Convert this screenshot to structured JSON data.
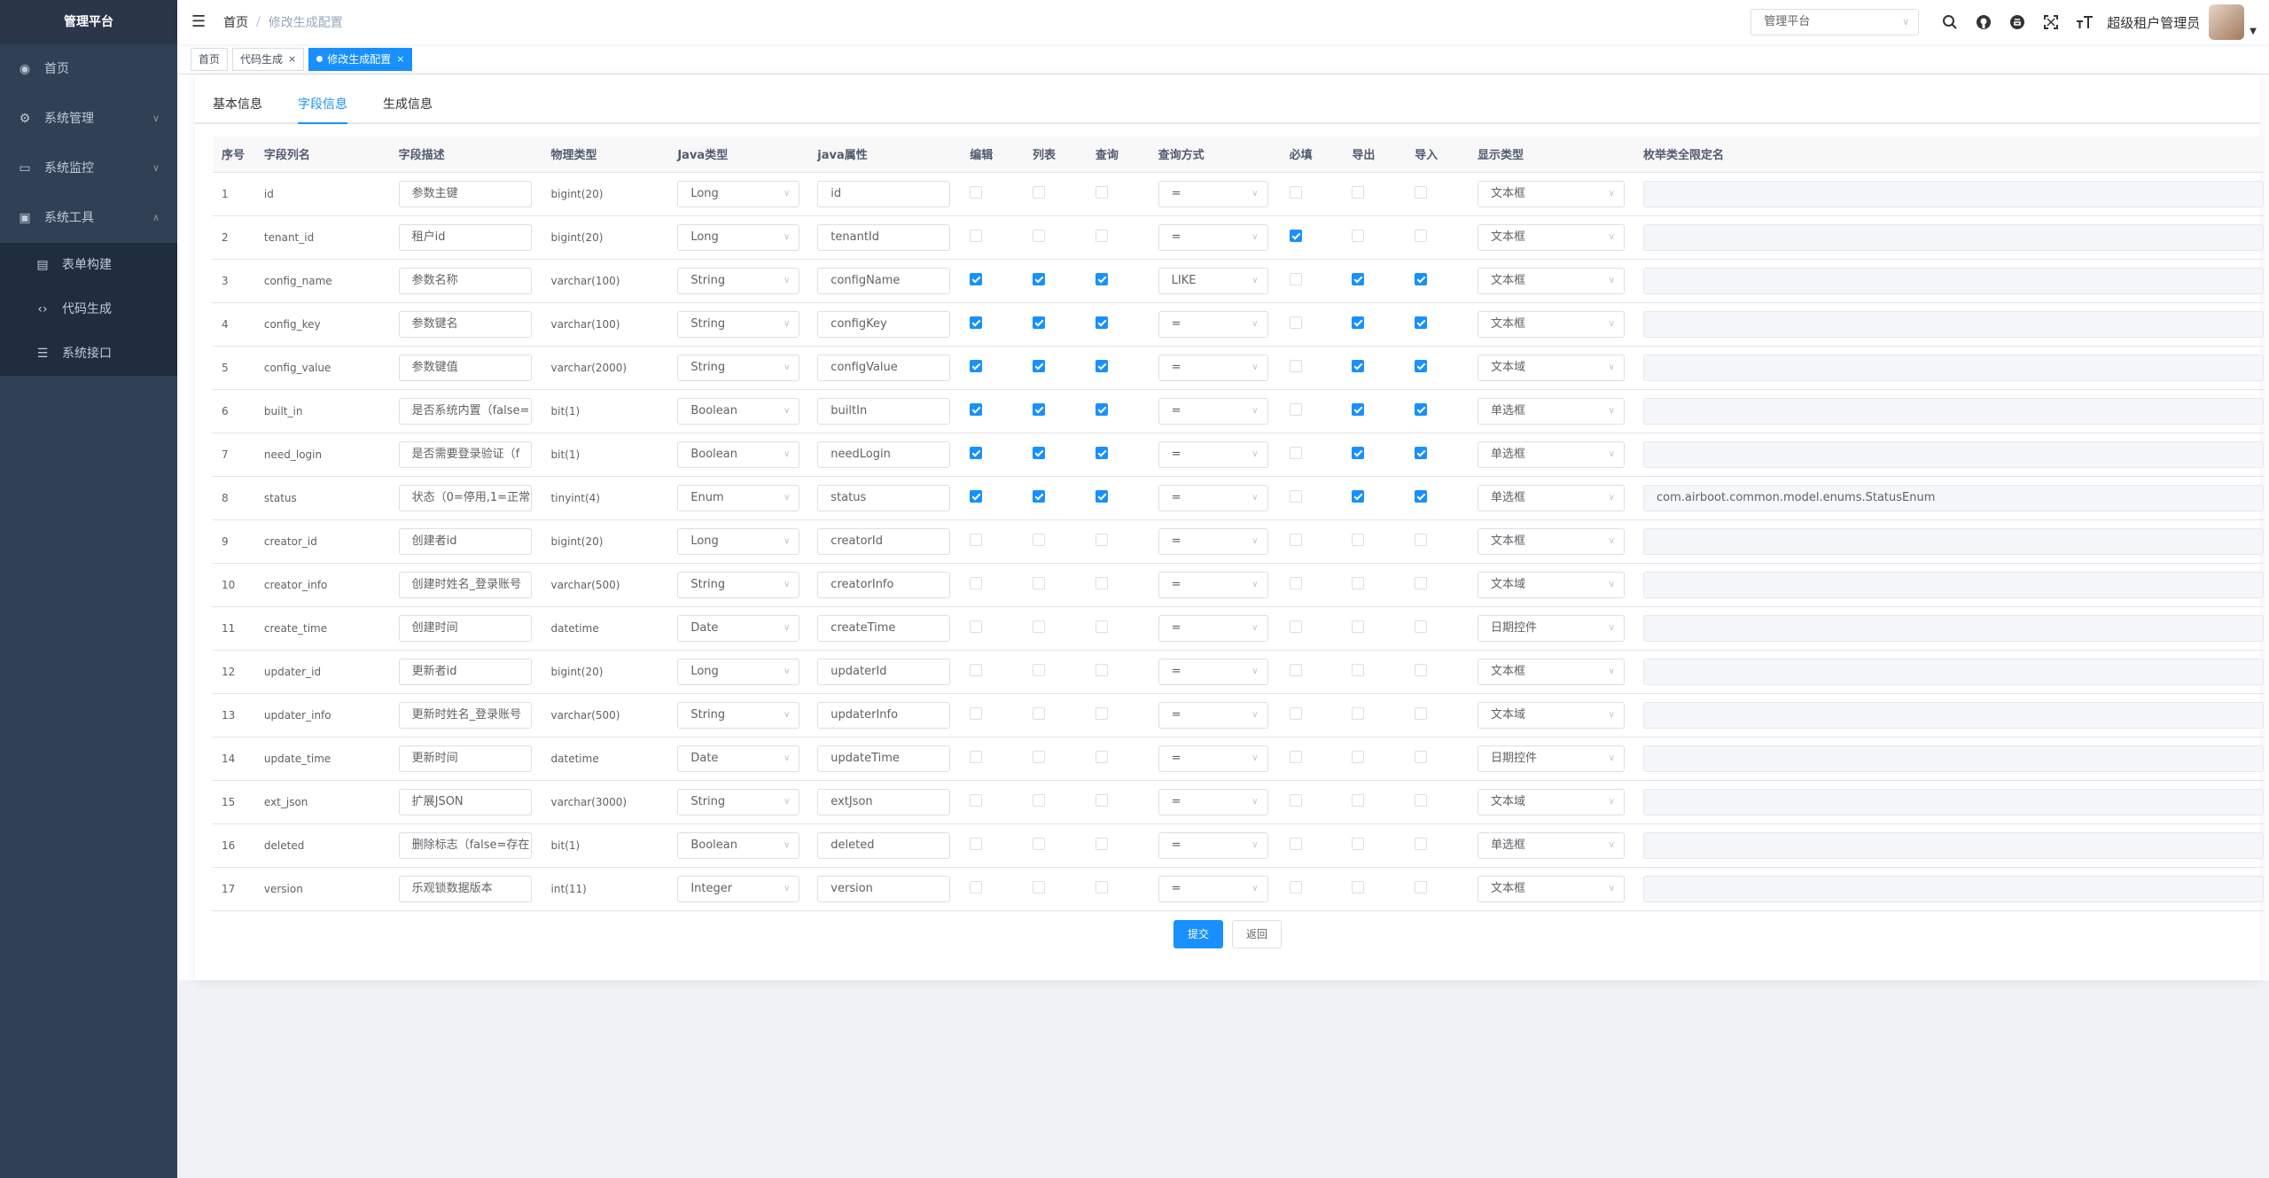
{
  "sidebar": {
    "title": "管理平台",
    "items": [
      {
        "label": "首页",
        "icon": "dashboard-icon"
      },
      {
        "label": "系统管理",
        "icon": "gear-icon"
      },
      {
        "label": "系统监控",
        "icon": "monitor-icon"
      },
      {
        "label": "系统工具",
        "icon": "toolbox-icon"
      }
    ],
    "subitems": [
      {
        "label": "表单构建",
        "icon": "form-icon"
      },
      {
        "label": "代码生成",
        "icon": "code-icon"
      },
      {
        "label": "系统接口",
        "icon": "sliders-icon"
      }
    ]
  },
  "navbar": {
    "breadcrumb_home": "首页",
    "breadcrumb_current": "修改生成配置",
    "app_select": "管理平台",
    "username": "超级租户管理员"
  },
  "tags": [
    {
      "label": "首页"
    },
    {
      "label": "代码生成"
    },
    {
      "label": "修改生成配置"
    }
  ],
  "tabs": [
    "基本信息",
    "字段信息",
    "生成信息"
  ],
  "table": {
    "headers": [
      "序号",
      "字段列名",
      "字段描述",
      "物理类型",
      "Java类型",
      "java属性",
      "编辑",
      "列表",
      "查询",
      "查询方式",
      "必填",
      "导出",
      "导入",
      "显示类型",
      "枚举类全限定名"
    ],
    "rows": [
      {
        "no": "1",
        "col": "id",
        "desc": "参数主键",
        "ptype": "bigint(20)",
        "jtype": "Long",
        "jprop": "id",
        "edit": false,
        "list": false,
        "query": false,
        "qtype": "=",
        "req": false,
        "exp": false,
        "imp": false,
        "disp": "文本框",
        "enum": ""
      },
      {
        "no": "2",
        "col": "tenant_id",
        "desc": "租户id",
        "ptype": "bigint(20)",
        "jtype": "Long",
        "jprop": "tenantId",
        "edit": false,
        "list": false,
        "query": false,
        "qtype": "=",
        "req": true,
        "exp": false,
        "imp": false,
        "disp": "文本框",
        "enum": ""
      },
      {
        "no": "3",
        "col": "config_name",
        "desc": "参数名称",
        "ptype": "varchar(100)",
        "jtype": "String",
        "jprop": "configName",
        "edit": true,
        "list": true,
        "query": true,
        "qtype": "LIKE",
        "req": false,
        "exp": true,
        "imp": true,
        "disp": "文本框",
        "enum": ""
      },
      {
        "no": "4",
        "col": "config_key",
        "desc": "参数键名",
        "ptype": "varchar(100)",
        "jtype": "String",
        "jprop": "configKey",
        "edit": true,
        "list": true,
        "query": true,
        "qtype": "=",
        "req": false,
        "exp": true,
        "imp": true,
        "disp": "文本框",
        "enum": ""
      },
      {
        "no": "5",
        "col": "config_value",
        "desc": "参数键值",
        "ptype": "varchar(2000)",
        "jtype": "String",
        "jprop": "configValue",
        "edit": true,
        "list": true,
        "query": true,
        "qtype": "=",
        "req": false,
        "exp": true,
        "imp": true,
        "disp": "文本域",
        "enum": ""
      },
      {
        "no": "6",
        "col": "built_in",
        "desc": "是否系统内置（false=",
        "ptype": "bit(1)",
        "jtype": "Boolean",
        "jprop": "builtIn",
        "edit": true,
        "list": true,
        "query": true,
        "qtype": "=",
        "req": false,
        "exp": true,
        "imp": true,
        "disp": "单选框",
        "enum": ""
      },
      {
        "no": "7",
        "col": "need_login",
        "desc": "是否需要登录验证（f",
        "ptype": "bit(1)",
        "jtype": "Boolean",
        "jprop": "needLogin",
        "edit": true,
        "list": true,
        "query": true,
        "qtype": "=",
        "req": false,
        "exp": true,
        "imp": true,
        "disp": "单选框",
        "enum": ""
      },
      {
        "no": "8",
        "col": "status",
        "desc": "状态（0=停用,1=正常",
        "ptype": "tinyint(4)",
        "jtype": "Enum",
        "jprop": "status",
        "edit": true,
        "list": true,
        "query": true,
        "qtype": "=",
        "req": false,
        "exp": true,
        "imp": true,
        "disp": "单选框",
        "enum": "com.airboot.common.model.enums.StatusEnum"
      },
      {
        "no": "9",
        "col": "creator_id",
        "desc": "创建者id",
        "ptype": "bigint(20)",
        "jtype": "Long",
        "jprop": "creatorId",
        "edit": false,
        "list": false,
        "query": false,
        "qtype": "=",
        "req": false,
        "exp": false,
        "imp": false,
        "disp": "文本框",
        "enum": ""
      },
      {
        "no": "10",
        "col": "creator_info",
        "desc": "创建时姓名_登录账号",
        "ptype": "varchar(500)",
        "jtype": "String",
        "jprop": "creatorInfo",
        "edit": false,
        "list": false,
        "query": false,
        "qtype": "=",
        "req": false,
        "exp": false,
        "imp": false,
        "disp": "文本域",
        "enum": ""
      },
      {
        "no": "11",
        "col": "create_time",
        "desc": "创建时间",
        "ptype": "datetime",
        "jtype": "Date",
        "jprop": "createTime",
        "edit": false,
        "list": false,
        "query": false,
        "qtype": "=",
        "req": false,
        "exp": false,
        "imp": false,
        "disp": "日期控件",
        "enum": ""
      },
      {
        "no": "12",
        "col": "updater_id",
        "desc": "更新者id",
        "ptype": "bigint(20)",
        "jtype": "Long",
        "jprop": "updaterId",
        "edit": false,
        "list": false,
        "query": false,
        "qtype": "=",
        "req": false,
        "exp": false,
        "imp": false,
        "disp": "文本框",
        "enum": ""
      },
      {
        "no": "13",
        "col": "updater_info",
        "desc": "更新时姓名_登录账号",
        "ptype": "varchar(500)",
        "jtype": "String",
        "jprop": "updaterInfo",
        "edit": false,
        "list": false,
        "query": false,
        "qtype": "=",
        "req": false,
        "exp": false,
        "imp": false,
        "disp": "文本域",
        "enum": ""
      },
      {
        "no": "14",
        "col": "update_time",
        "desc": "更新时间",
        "ptype": "datetime",
        "jtype": "Date",
        "jprop": "updateTime",
        "edit": false,
        "list": false,
        "query": false,
        "qtype": "=",
        "req": false,
        "exp": false,
        "imp": false,
        "disp": "日期控件",
        "enum": ""
      },
      {
        "no": "15",
        "col": "ext_json",
        "desc": "扩展JSON",
        "ptype": "varchar(3000)",
        "jtype": "String",
        "jprop": "extJson",
        "edit": false,
        "list": false,
        "query": false,
        "qtype": "=",
        "req": false,
        "exp": false,
        "imp": false,
        "disp": "文本域",
        "enum": ""
      },
      {
        "no": "16",
        "col": "deleted",
        "desc": "删除标志（false=存在",
        "ptype": "bit(1)",
        "jtype": "Boolean",
        "jprop": "deleted",
        "edit": false,
        "list": false,
        "query": false,
        "qtype": "=",
        "req": false,
        "exp": false,
        "imp": false,
        "disp": "单选框",
        "enum": ""
      },
      {
        "no": "17",
        "col": "version",
        "desc": "乐观锁数据版本",
        "ptype": "int(11)",
        "jtype": "Integer",
        "jprop": "version",
        "edit": false,
        "list": false,
        "query": false,
        "qtype": "=",
        "req": false,
        "exp": false,
        "imp": false,
        "disp": "文本框",
        "enum": ""
      }
    ]
  },
  "buttons": {
    "submit": "提交",
    "back": "返回"
  },
  "colors": {
    "accent": "#1890ff",
    "sidebar_bg": "#304156",
    "sidebar_text": "#bfcbd9"
  }
}
